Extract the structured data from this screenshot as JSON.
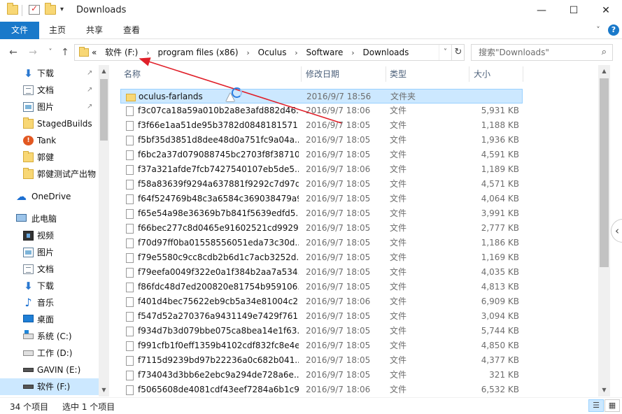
{
  "window": {
    "title": "Downloads",
    "qa_dropdown": "▾",
    "minimize": "—",
    "maximize": "☐",
    "close": "✕"
  },
  "ribbon": {
    "tabs": [
      {
        "label": "文件",
        "active": true
      },
      {
        "label": "主页"
      },
      {
        "label": "共享"
      },
      {
        "label": "查看"
      }
    ],
    "collapse": "˅",
    "help": "?"
  },
  "navigation": {
    "back": "←",
    "forward": "→",
    "recent": "˅",
    "up": "↑"
  },
  "address": {
    "overflow": "«",
    "crumbs": [
      "软件 (F:)",
      "program files (x86)",
      "Oculus",
      "Software",
      "Downloads"
    ],
    "separator": "›",
    "dropdown": "˅",
    "refresh": "↻"
  },
  "search": {
    "placeholder": "搜索\"Downloads\"",
    "icon": "search-icon"
  },
  "sidebar": {
    "items": [
      {
        "label": "下载",
        "icon": "download-icon",
        "pinned": true
      },
      {
        "label": "文档",
        "icon": "document-icon",
        "pinned": true
      },
      {
        "label": "图片",
        "icon": "picture-icon",
        "pinned": true
      },
      {
        "label": "StagedBuilds",
        "icon": "folder-icon"
      },
      {
        "label": "Tank",
        "icon": "tank-app-icon"
      },
      {
        "label": "郭健",
        "icon": "folder-icon"
      },
      {
        "label": "郭健测试产出物",
        "icon": "folder-icon"
      },
      {
        "label": "OneDrive",
        "icon": "onedrive-icon"
      },
      {
        "label": "此电脑",
        "icon": "this-pc-icon"
      },
      {
        "label": "视频",
        "icon": "video-icon"
      },
      {
        "label": "图片",
        "icon": "picture-icon"
      },
      {
        "label": "文档",
        "icon": "document-icon"
      },
      {
        "label": "下载",
        "icon": "download-icon"
      },
      {
        "label": "音乐",
        "icon": "music-icon"
      },
      {
        "label": "桌面",
        "icon": "desktop-icon"
      },
      {
        "label": "系统 (C:)",
        "icon": "system-drive-icon"
      },
      {
        "label": "工作 (D:)",
        "icon": "drive-icon"
      },
      {
        "label": "GAVIN (E:)",
        "icon": "drive-icon"
      },
      {
        "label": "软件 (F:)",
        "icon": "drive-icon",
        "selected": true
      }
    ],
    "pin_glyph": "↗"
  },
  "columns": {
    "name": "名称",
    "date": "修改日期",
    "type": "类型",
    "size": "大小",
    "sort_indicator": "˄"
  },
  "files": [
    {
      "name": "oculus-farlands",
      "date": "2016/9/7 18:56",
      "type": "文件夹",
      "size": "",
      "folder": true,
      "selected": true
    },
    {
      "name": "f3c07ca18a59a010b2a8e3afd882d46...",
      "date": "2016/9/7 18:06",
      "type": "文件",
      "size": "5,931 KB"
    },
    {
      "name": "f3f66e1aa51de95b3782d0848181571...",
      "date": "2016/9/7 18:05",
      "type": "文件",
      "size": "1,188 KB"
    },
    {
      "name": "f5bf35d3851d8dee48d0a751fc9a04a...",
      "date": "2016/9/7 18:05",
      "type": "文件",
      "size": "1,936 KB"
    },
    {
      "name": "f6bc2a37d079088745bc2703f8f38710...",
      "date": "2016/9/7 18:05",
      "type": "文件",
      "size": "4,591 KB"
    },
    {
      "name": "f37a321afde7fcb7427540107eb5de5...",
      "date": "2016/9/7 18:06",
      "type": "文件",
      "size": "1,189 KB"
    },
    {
      "name": "f58a83639f9294a637881f9292c7d97d...",
      "date": "2016/9/7 18:05",
      "type": "文件",
      "size": "4,571 KB"
    },
    {
      "name": "f64f524769b48c3a6584c369038479a9...",
      "date": "2016/9/7 18:05",
      "type": "文件",
      "size": "4,064 KB"
    },
    {
      "name": "f65e54a98e36369b7b841f5639edfd5...",
      "date": "2016/9/7 18:05",
      "type": "文件",
      "size": "3,991 KB"
    },
    {
      "name": "f66bec277c8d0465e91602521cd9929...",
      "date": "2016/9/7 18:05",
      "type": "文件",
      "size": "2,777 KB"
    },
    {
      "name": "f70d97ff0ba01558556051eda73c30d...",
      "date": "2016/9/7 18:05",
      "type": "文件",
      "size": "1,186 KB"
    },
    {
      "name": "f79e5580c9cc8cdb2b6d1c7acb3252d...",
      "date": "2016/9/7 18:05",
      "type": "文件",
      "size": "1,169 KB"
    },
    {
      "name": "f79eefa0049f322e0a1f384b2aa7a534...",
      "date": "2016/9/7 18:05",
      "type": "文件",
      "size": "4,035 KB"
    },
    {
      "name": "f86fdc48d7ed200820e81754b959106...",
      "date": "2016/9/7 18:05",
      "type": "文件",
      "size": "4,813 KB"
    },
    {
      "name": "f401d4bec75622eb9cb5a34e81004c2...",
      "date": "2016/9/7 18:06",
      "type": "文件",
      "size": "6,909 KB"
    },
    {
      "name": "f547d52a270376a9431149e7429f761...",
      "date": "2016/9/7 18:05",
      "type": "文件",
      "size": "3,094 KB"
    },
    {
      "name": "f934d7b3d079bbe075ca8bea14e1f63...",
      "date": "2016/9/7 18:05",
      "type": "文件",
      "size": "5,744 KB"
    },
    {
      "name": "f991cfb1f0eff1359b4102cdf832fc8e4e...",
      "date": "2016/9/7 18:05",
      "type": "文件",
      "size": "4,850 KB"
    },
    {
      "name": "f7115d9239bd97b22236a0c682b041...",
      "date": "2016/9/7 18:05",
      "type": "文件",
      "size": "4,377 KB"
    },
    {
      "name": "f734043d3bb6e2ebc9a294de728a6e...",
      "date": "2016/9/7 18:05",
      "type": "文件",
      "size": "321 KB"
    },
    {
      "name": "f5065608de4081cdf43eef7284a6b1c9...",
      "date": "2016/9/7 18:06",
      "type": "文件",
      "size": "6,532 KB"
    }
  ],
  "status": {
    "item_count": "34 个项目",
    "selected": "选中 1 个项目"
  },
  "colors": {
    "accent": "#1979ca",
    "selection": "#cce8ff",
    "annotation": "#e0202a"
  }
}
